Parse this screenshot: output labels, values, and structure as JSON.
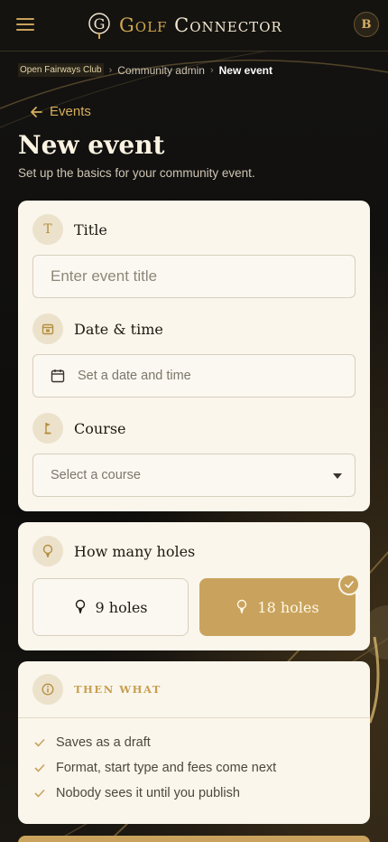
{
  "header": {
    "menu_icon": "hamburger-menu-icon",
    "brand_mark": "G",
    "brand_word1": "Golf",
    "brand_word2": "Connector",
    "avatar_initial": "B"
  },
  "breadcrumb": {
    "items": [
      "Open Fairways Club",
      "Community admin",
      "New event"
    ],
    "separator": "›"
  },
  "back_link": {
    "label": "Events",
    "icon": "arrow-left-icon"
  },
  "page": {
    "title": "New event",
    "subtitle": "Set up the basics for your community event."
  },
  "form": {
    "title": {
      "icon_glyph": "T",
      "label": "Title",
      "placeholder": "Enter event title",
      "value": ""
    },
    "datetime": {
      "icon": "calendar-icon",
      "label": "Date & time",
      "placeholder": "Set a date and time"
    },
    "course": {
      "icon": "golf-flag-icon",
      "label": "Course",
      "placeholder": "Select a course"
    }
  },
  "holes": {
    "label": "How many holes",
    "icon": "golf-ball-tee-icon",
    "options": [
      {
        "label": "9 holes",
        "selected": false
      },
      {
        "label": "18 holes",
        "selected": true
      }
    ]
  },
  "then_what": {
    "heading": "THEN WHAT",
    "icon": "info-icon",
    "items": [
      "Saves as a draft",
      "Format, start type and fees come next",
      "Nobody sees it until you publish"
    ]
  },
  "colors": {
    "accent": "#c9a35d",
    "card": "#faf6ec",
    "background": "#121110"
  }
}
